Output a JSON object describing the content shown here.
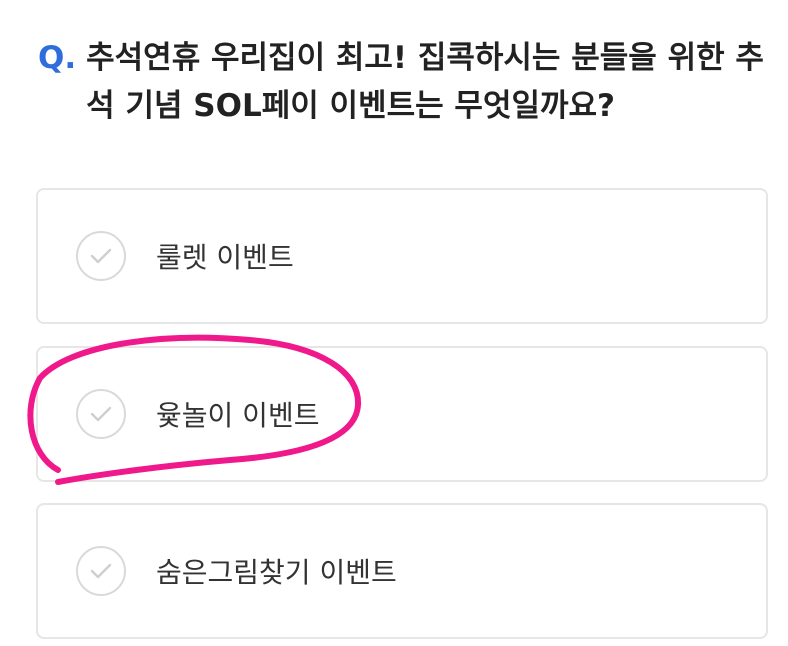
{
  "question": {
    "prefix": "Q.",
    "text": "추석연휴 우리집이 최고! 집콕하시는 분들을 위한 추석 기념 SOL페이 이벤트는 무엇일까요?"
  },
  "options": [
    {
      "label": "룰렛 이벤트",
      "icon": "check-circle-icon"
    },
    {
      "label": "윷놀이 이벤트",
      "icon": "check-circle-icon"
    },
    {
      "label": "숨은그림찾기 이벤트",
      "icon": "check-circle-icon"
    }
  ],
  "colors": {
    "accent": "#2e6ddc",
    "annotation": "#f0198c",
    "border": "#e6e6e6",
    "check": "#d9d9d9"
  },
  "annotation": {
    "type": "hand-drawn-circle",
    "target": "윷놀이 이벤트"
  }
}
